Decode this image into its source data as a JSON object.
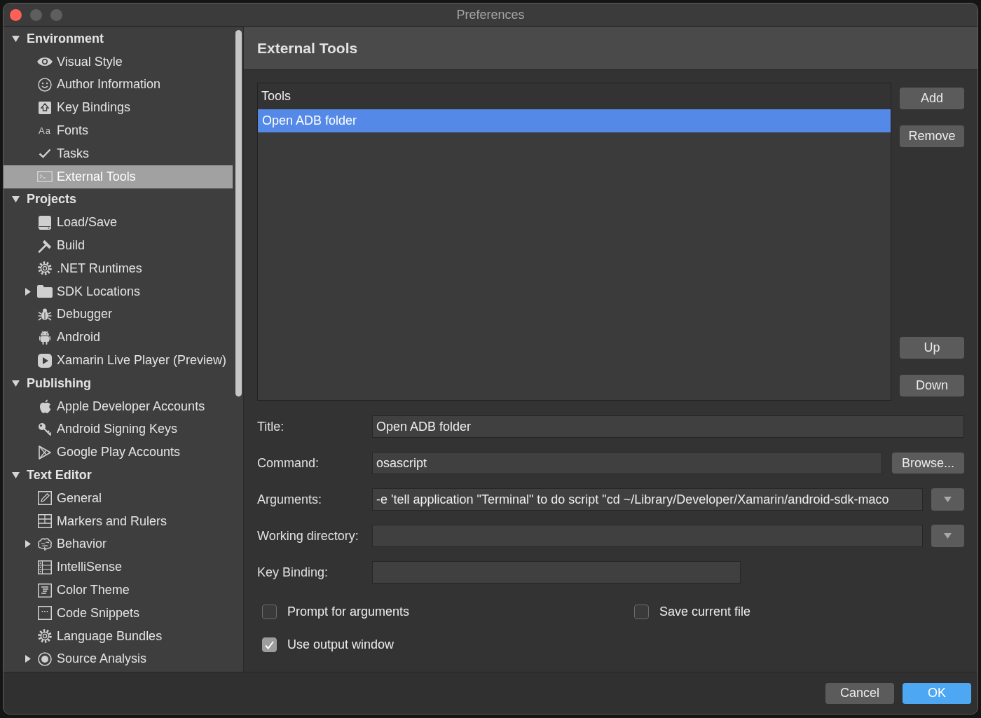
{
  "window": {
    "title": "Preferences"
  },
  "sidebar": {
    "sections": [
      {
        "label": "Environment",
        "expanded": true,
        "selected": false,
        "items": [
          {
            "label": "Visual Style",
            "selected": false
          },
          {
            "label": "Author Information",
            "selected": false
          },
          {
            "label": "Key Bindings",
            "selected": false
          },
          {
            "label": "Fonts",
            "icon_text": "Aa",
            "selected": false
          },
          {
            "label": "Tasks",
            "selected": false
          },
          {
            "label": "External Tools",
            "selected": true
          }
        ]
      },
      {
        "label": "Projects",
        "expanded": true,
        "selected": false,
        "items": [
          {
            "label": "Load/Save",
            "selected": false
          },
          {
            "label": "Build",
            "selected": false
          },
          {
            "label": ".NET Runtimes",
            "selected": false
          },
          {
            "label": "SDK Locations",
            "expanded": false,
            "selected": false
          },
          {
            "label": "Debugger",
            "selected": false
          },
          {
            "label": "Android",
            "selected": false
          },
          {
            "label": "Xamarin Live Player (Preview)",
            "selected": false
          }
        ]
      },
      {
        "label": "Publishing",
        "expanded": true,
        "selected": false,
        "items": [
          {
            "label": "Apple Developer Accounts",
            "selected": false
          },
          {
            "label": "Android Signing Keys",
            "selected": false
          },
          {
            "label": "Google Play Accounts",
            "selected": false
          }
        ]
      },
      {
        "label": "Text Editor",
        "expanded": true,
        "selected": false,
        "items": [
          {
            "label": "General",
            "selected": false
          },
          {
            "label": "Markers and Rulers",
            "selected": false
          },
          {
            "label": "Behavior",
            "expanded": false,
            "selected": false
          },
          {
            "label": "IntelliSense",
            "selected": false
          },
          {
            "label": "Color Theme",
            "selected": false
          },
          {
            "label": "Code Snippets",
            "selected": false
          },
          {
            "label": "Language Bundles",
            "selected": false
          },
          {
            "label": "Source Analysis",
            "expanded": false,
            "selected": false
          }
        ]
      }
    ]
  },
  "panel": {
    "title": "External Tools"
  },
  "tools_list": {
    "header": "Tools",
    "rows": [
      {
        "label": "Open ADB folder",
        "selected": true
      }
    ]
  },
  "list_buttons": {
    "top": [
      "Add",
      "Remove"
    ],
    "bottom": [
      "Up",
      "Down"
    ]
  },
  "form": {
    "fields": [
      {
        "label": "Title:",
        "kind": "text",
        "value": "Open ADB folder"
      },
      {
        "label": "Command:",
        "kind": "file",
        "value": "osascript",
        "button": "Browse..."
      },
      {
        "label": "Arguments:",
        "kind": "combo",
        "value": "-e 'tell application \"Terminal\" to do script \"cd ~/Library/Developer/Xamarin/android-sdk-maco"
      },
      {
        "label": "Working directory:",
        "kind": "combo"
      },
      {
        "label": "Key Binding:",
        "kind": "shortcut"
      }
    ]
  },
  "options": [
    {
      "label": "Prompt for arguments",
      "checked": false
    },
    {
      "label": "Save current file",
      "checked": false
    },
    {
      "label": "Use output window",
      "checked": true
    }
  ],
  "buttons": [
    {
      "label": "Cancel",
      "kind": "cancel"
    },
    {
      "label": "OK",
      "kind": "confirm"
    }
  ]
}
